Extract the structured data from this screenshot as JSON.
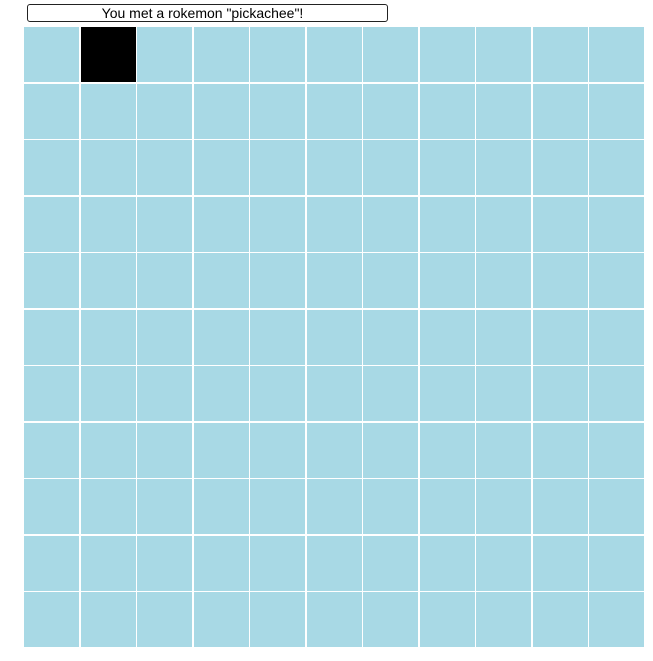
{
  "message": {
    "text": "You met a rokemon \"pickachee\"!"
  },
  "board": {
    "rows": 11,
    "cols": 11,
    "player_cell": {
      "row": 0,
      "col": 1
    },
    "colors": {
      "tile": "#a8d9e5",
      "player": "#000000",
      "grid_line": "#ffffff"
    }
  }
}
